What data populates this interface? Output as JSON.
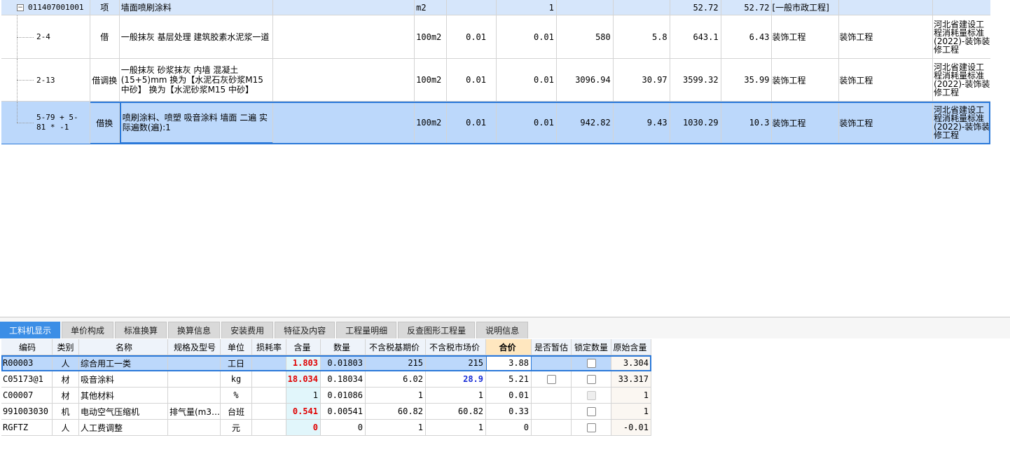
{
  "upper_rows": [
    {
      "code": "011407001001",
      "type": "项",
      "name": "墙面喷刷涂料",
      "spec": "",
      "unit": "m2",
      "quota_qty": "",
      "qty": "1",
      "p1": "",
      "p2": "",
      "p3": "52.72",
      "p4": "52.72",
      "specialty": "[一般市政工程]",
      "specialty2": "",
      "std": ""
    },
    {
      "code": "2-4",
      "type": "借",
      "name": "一般抹灰 基层处理 建筑胶素水泥浆一道",
      "spec": "",
      "unit": "100m2",
      "quota_qty": "0.01",
      "qty": "0.01",
      "p1": "580",
      "p2": "5.8",
      "p3": "643.1",
      "p4": "6.43",
      "specialty": "装饰工程",
      "specialty2": "装饰工程",
      "std": "河北省建设工程消耗量标准(2022)-装饰装修工程"
    },
    {
      "code": "2-13",
      "type": "借调换",
      "name": "一般抹灰 砂浆抹灰 内墙 混凝土 (15+5)mm  换为【水泥石灰砂浆M15 中砂】  换为【水泥砂浆M15 中砂】",
      "spec": "",
      "unit": "100m2",
      "quota_qty": "0.01",
      "qty": "0.01",
      "p1": "3096.94",
      "p2": "30.97",
      "p3": "3599.32",
      "p4": "35.99",
      "specialty": "装饰工程",
      "specialty2": "装饰工程",
      "std": "河北省建设工程消耗量标准(2022)-装饰装修工程"
    },
    {
      "code": "5-79 + 5-81 * -1",
      "type": "借换",
      "name": "喷刷涂料、喷塑 吸音涂料 墙面 二遍 实际遍数(遍):1",
      "spec": "",
      "unit": "100m2",
      "quota_qty": "0.01",
      "qty": "0.01",
      "p1": "942.82",
      "p2": "9.43",
      "p3": "1030.29",
      "p4": "10.3",
      "specialty": "装饰工程",
      "specialty2": "装饰工程",
      "std": "河北省建设工程消耗量标准(2022)-装饰装修工程"
    }
  ],
  "tabs": [
    "工料机显示",
    "单价构成",
    "标准换算",
    "换算信息",
    "安装费用",
    "特征及内容",
    "工程量明细",
    "反查图形工程量",
    "说明信息"
  ],
  "active_tab": 0,
  "headers": [
    "编码",
    "类别",
    "名称",
    "规格及型号",
    "单位",
    "损耗率",
    "含量",
    "数量",
    "不含税基期价",
    "不含税市场价",
    "合价",
    "是否暂估",
    "锁定数量",
    "原始含量"
  ],
  "rows": [
    {
      "code": "R00003",
      "cat": "人",
      "name": "综合用工一类",
      "spec": "",
      "unit": "工日",
      "loss": "",
      "content": "1.803",
      "qty": "0.01803",
      "base_price": "215",
      "market_price": "215",
      "total": "3.88",
      "provisional": false,
      "lock": "box",
      "orig": "3.304"
    },
    {
      "code": "C05173@1",
      "cat": "材",
      "name": "吸音涂料",
      "spec": "",
      "unit": "kg",
      "loss": "",
      "content": "18.034",
      "qty": "0.18034",
      "base_price": "6.02",
      "market_price": "28.9",
      "total": "5.21",
      "provisional": true,
      "lock": "box",
      "orig": "33.317"
    },
    {
      "code": "C00007",
      "cat": "材",
      "name": "其他材料",
      "spec": "",
      "unit": "%",
      "loss": "",
      "content": "1",
      "qty": "0.01086",
      "base_price": "1",
      "market_price": "1",
      "total": "0.01",
      "provisional": false,
      "lock": "disabled",
      "orig": "1"
    },
    {
      "code": "991003030",
      "cat": "机",
      "name": "电动空气压缩机",
      "spec": "排气量(m3…",
      "unit": "台班",
      "loss": "",
      "content": "0.541",
      "qty": "0.00541",
      "base_price": "60.82",
      "market_price": "60.82",
      "total": "0.33",
      "provisional": false,
      "lock": "box",
      "orig": "1"
    },
    {
      "code": "RGFTZ",
      "cat": "人",
      "name": "人工费调整",
      "spec": "",
      "unit": "元",
      "loss": "",
      "content": "0",
      "qty": "0",
      "base_price": "1",
      "market_price": "1",
      "total": "0",
      "provisional": false,
      "lock": "box",
      "orig": "-0.01"
    }
  ],
  "colors": {
    "selection": "#bcd8fb",
    "selection_border": "#2b79d9",
    "tab_active": "#3b8ee6",
    "content_red": "#e00000",
    "market_blue": "#1a2fd6",
    "total_header": "#ffe7bf"
  }
}
